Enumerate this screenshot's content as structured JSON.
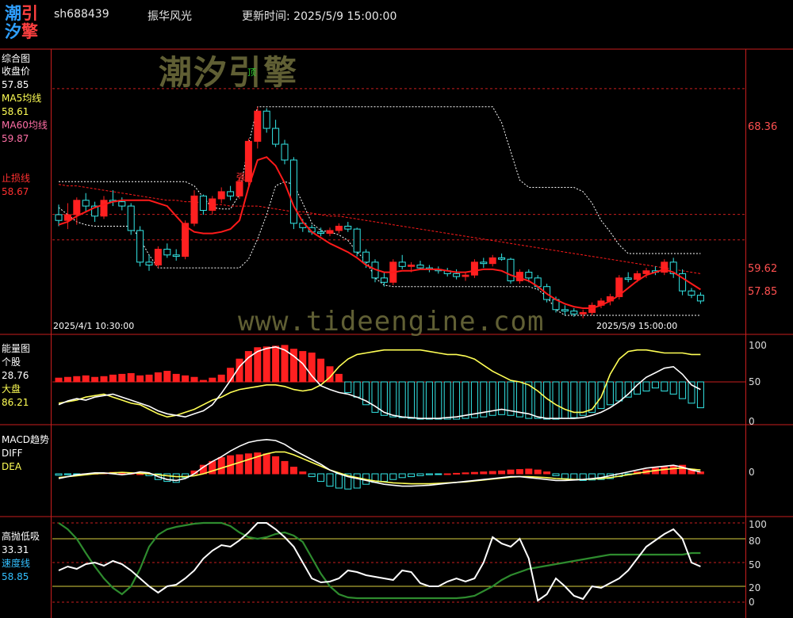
{
  "header": {
    "logo_chars": [
      "潮",
      "引",
      "汐",
      "擎"
    ],
    "code": "sh688439",
    "name": "振华风光",
    "update_time": "更新时间: 2025/5/9 15:00:00"
  },
  "watermarks": {
    "cn": "潮汐引擎",
    "url": "www.tideengine.com"
  },
  "panels": {
    "main": {
      "title": "综合图",
      "close_label": "收盘价",
      "close_value": "57.85",
      "ma5_label": "MA5均线",
      "ma5_value": "58.61",
      "ma60_label": "MA60均线",
      "ma60_value": "59.87",
      "stop_label": "止损线",
      "stop_value": "58.67",
      "date_start": "2025/4/1 10:30:00",
      "date_end": "2025/5/9 15:00:00",
      "right_ticks": [
        "68.36",
        "59.62",
        "57.85"
      ],
      "marks": {
        "top": "顶",
        "strong": "强"
      }
    },
    "energy": {
      "title": "能量图",
      "stock_label": "个股",
      "stock_value": "28.76",
      "market_label": "大盘",
      "market_value": "86.21",
      "ticks": [
        "100",
        "50",
        "0"
      ]
    },
    "macd": {
      "title": "MACD趋势",
      "diff_label": "DIFF",
      "dea_label": "DEA",
      "ticks": [
        "0"
      ]
    },
    "osc": {
      "title": "高抛低吸",
      "value": "33.31",
      "speed_label": "速度线",
      "speed_value": "58.85",
      "ticks": [
        "100",
        "80",
        "50",
        "20",
        "0"
      ]
    }
  },
  "colors": {
    "up": "#ff2020",
    "down": "#33e6e6",
    "ma60": "#ff1a1a",
    "yellow": "#ffff55",
    "white": "#ffffff",
    "green": "#2e8b2e",
    "grid": "#c81e1e",
    "label_white": "#ffffff",
    "label_yellow": "#ffff55",
    "label_pink": "#ff6fa6",
    "label_red": "#ff3030",
    "label_cyan": "#33c0ff"
  },
  "chart_data": {
    "type": "line",
    "bars_count": 72,
    "candles": [
      [
        59.6,
        60.3,
        58.8,
        59.2
      ],
      [
        59.2,
        60.4,
        58.6,
        59.6
      ],
      [
        59.6,
        60.8,
        58.9,
        60.6
      ],
      [
        60.6,
        61.1,
        59.8,
        60.2
      ],
      [
        60.2,
        60.5,
        59.1,
        59.5
      ],
      [
        59.5,
        60.9,
        59.3,
        60.6
      ],
      [
        60.6,
        61.3,
        60.2,
        60.5
      ],
      [
        60.5,
        60.8,
        59.9,
        60.2
      ],
      [
        60.2,
        60.4,
        58.2,
        58.5
      ],
      [
        58.5,
        58.8,
        56.0,
        56.3
      ],
      [
        56.3,
        56.8,
        55.7,
        56.1
      ],
      [
        56.1,
        57.4,
        55.9,
        57.2
      ],
      [
        57.2,
        57.6,
        56.6,
        56.8
      ],
      [
        56.8,
        57.2,
        56.4,
        56.7
      ],
      [
        56.7,
        59.2,
        56.5,
        59.0
      ],
      [
        59.0,
        61.3,
        58.8,
        60.9
      ],
      [
        60.9,
        61.0,
        59.6,
        59.9
      ],
      [
        59.9,
        60.9,
        59.6,
        60.7
      ],
      [
        60.7,
        61.5,
        60.4,
        61.2
      ],
      [
        61.2,
        61.6,
        60.6,
        60.9
      ],
      [
        60.9,
        62.2,
        60.7,
        61.9
      ],
      [
        61.9,
        64.9,
        61.6,
        64.7
      ],
      [
        64.7,
        67.1,
        64.2,
        66.8
      ],
      [
        66.8,
        67.0,
        65.3,
        65.6
      ],
      [
        65.6,
        66.2,
        64.3,
        64.5
      ],
      [
        64.5,
        64.8,
        63.1,
        63.4
      ],
      [
        63.4,
        63.6,
        58.6,
        59.0
      ],
      [
        59.0,
        59.3,
        58.4,
        58.7
      ],
      [
        58.7,
        58.9,
        58.2,
        58.4
      ],
      [
        58.4,
        58.7,
        58.1,
        58.3
      ],
      [
        58.3,
        58.7,
        58.1,
        58.5
      ],
      [
        58.5,
        59.0,
        58.3,
        58.8
      ],
      [
        58.8,
        59.1,
        58.4,
        58.6
      ],
      [
        58.6,
        58.7,
        56.7,
        57.0
      ],
      [
        57.0,
        57.2,
        55.9,
        56.3
      ],
      [
        56.3,
        56.5,
        54.9,
        55.2
      ],
      [
        55.2,
        55.6,
        54.6,
        54.9
      ],
      [
        54.9,
        56.5,
        54.7,
        56.3
      ],
      [
        56.3,
        56.8,
        55.8,
        56.0
      ],
      [
        56.0,
        56.3,
        55.6,
        56.1
      ],
      [
        56.1,
        56.4,
        55.8,
        55.9
      ],
      [
        55.9,
        56.1,
        55.6,
        55.8
      ],
      [
        55.8,
        56.0,
        55.5,
        55.7
      ],
      [
        55.7,
        55.9,
        55.3,
        55.5
      ],
      [
        55.5,
        55.8,
        55.1,
        55.3
      ],
      [
        55.3,
        55.6,
        55.0,
        55.4
      ],
      [
        55.4,
        56.5,
        55.2,
        56.3
      ],
      [
        56.3,
        56.6,
        55.9,
        56.2
      ],
      [
        56.2,
        56.8,
        56.0,
        56.6
      ],
      [
        56.6,
        56.9,
        56.4,
        56.5
      ],
      [
        56.5,
        56.6,
        54.8,
        55.0
      ],
      [
        55.0,
        55.8,
        54.8,
        55.6
      ],
      [
        55.6,
        55.8,
        54.9,
        55.2
      ],
      [
        55.2,
        55.4,
        54.4,
        54.6
      ],
      [
        54.6,
        54.8,
        53.5,
        53.7
      ],
      [
        53.7,
        53.9,
        52.8,
        53.0
      ],
      [
        53.0,
        53.3,
        52.6,
        52.9
      ],
      [
        52.9,
        53.1,
        52.5,
        52.7
      ],
      [
        52.7,
        53.0,
        52.4,
        52.8
      ],
      [
        52.8,
        53.5,
        52.6,
        53.3
      ],
      [
        53.3,
        53.8,
        53.1,
        53.6
      ],
      [
        53.6,
        54.1,
        53.3,
        53.9
      ],
      [
        53.9,
        55.4,
        53.7,
        55.2
      ],
      [
        55.2,
        55.6,
        54.9,
        55.1
      ],
      [
        55.1,
        55.7,
        54.9,
        55.5
      ],
      [
        55.5,
        55.9,
        55.2,
        55.7
      ],
      [
        55.7,
        56.0,
        55.4,
        55.6
      ],
      [
        55.6,
        56.5,
        55.4,
        56.3
      ],
      [
        56.3,
        56.6,
        55.2,
        55.5
      ],
      [
        55.5,
        55.8,
        54.0,
        54.3
      ],
      [
        54.3,
        54.5,
        53.8,
        54.0
      ],
      [
        54.0,
        54.2,
        53.4,
        53.6
      ]
    ],
    "ma5": [
      59.9,
      59.9,
      60.0,
      60.1,
      60.0,
      59.9,
      60.0,
      59.9,
      59.6,
      59.0,
      58.4,
      57.8,
      57.1,
      56.6,
      57.0,
      57.8,
      58.6,
      59.4,
      60.0,
      60.6,
      60.8,
      61.8,
      63.0,
      63.6,
      63.9,
      63.8,
      62.8,
      61.6,
      60.6,
      59.4,
      58.6,
      58.4,
      58.3,
      58.0,
      57.6,
      57.0,
      56.5,
      56.0,
      55.8,
      55.6,
      55.5,
      55.5,
      55.6,
      55.6,
      55.5,
      55.4,
      55.5,
      55.6,
      55.7,
      55.8,
      55.8,
      55.8,
      55.6,
      55.3,
      54.9,
      54.5,
      54.0,
      53.6,
      53.2,
      53.1,
      53.2,
      53.4,
      53.8,
      54.2,
      54.6,
      55.0,
      55.3,
      55.5,
      55.6,
      55.5,
      55.2,
      54.8
    ],
    "ma60": [
      61.7,
      61.6,
      61.6,
      61.5,
      61.4,
      61.3,
      61.2,
      61.1,
      61.0,
      60.9,
      60.8,
      60.7,
      60.6,
      60.6,
      60.5,
      60.5,
      60.4,
      60.3,
      60.3,
      60.2,
      60.2,
      60.2,
      60.2,
      60.1,
      60.0,
      59.9,
      59.8,
      59.8,
      59.7,
      59.6,
      59.5,
      59.5,
      59.4,
      59.3,
      59.2,
      59.1,
      59.0,
      58.9,
      58.8,
      58.7,
      58.6,
      58.5,
      58.4,
      58.3,
      58.2,
      58.1,
      58.0,
      57.9,
      57.8,
      57.7,
      57.6,
      57.5,
      57.4,
      57.3,
      57.2,
      57.1,
      57.0,
      56.9,
      56.8,
      56.7,
      56.6,
      56.5,
      56.4,
      56.3,
      56.2,
      56.1,
      56.0,
      55.9,
      55.8,
      55.7,
      55.6,
      55.5
    ],
    "stop_line": [
      58.9,
      59.1,
      59.5,
      59.8,
      60.1,
      60.3,
      60.5,
      60.6,
      60.6,
      60.6,
      60.6,
      60.4,
      60.2,
      59.5,
      58.8,
      58.4,
      58.3,
      58.3,
      58.4,
      58.6,
      59.2,
      61.5,
      63.4,
      63.6,
      63.0,
      61.8,
      60.2,
      59.1,
      58.4,
      58.0,
      57.6,
      57.3,
      57.0,
      56.6,
      56.1,
      55.8,
      55.6,
      55.6,
      55.7,
      55.7,
      55.8,
      55.8,
      55.8,
      55.7,
      55.6,
      55.6,
      55.7,
      55.8,
      55.8,
      55.7,
      55.4,
      55.2,
      55.0,
      54.6,
      54.1,
      53.7,
      53.4,
      53.2,
      53.1,
      53.1,
      53.3,
      53.6,
      54.0,
      54.5,
      55.0,
      55.4,
      55.6,
      55.8,
      55.6,
      55.2,
      54.8,
      54.4
    ],
    "resistance": [
      61.9,
      61.9,
      61.9,
      61.9,
      61.9,
      61.9,
      61.9,
      61.9,
      61.9,
      61.9,
      61.9,
      61.9,
      61.9,
      61.9,
      61.9,
      61.6,
      60.8,
      60.1,
      60.0,
      60.0,
      61.0,
      64.5,
      67.1,
      67.1,
      67.1,
      67.1,
      67.1,
      67.1,
      67.1,
      67.1,
      67.1,
      67.1,
      67.1,
      67.1,
      67.1,
      67.1,
      67.1,
      67.1,
      67.1,
      67.1,
      67.1,
      67.1,
      67.1,
      67.1,
      67.1,
      67.1,
      67.1,
      67.1,
      67.1,
      66.0,
      64.0,
      62.0,
      61.5,
      61.5,
      61.5,
      61.5,
      61.5,
      61.5,
      61.2,
      60.4,
      59.2,
      58.4,
      57.5,
      56.9,
      56.9,
      56.9,
      56.9,
      56.9,
      56.9,
      56.9,
      56.9,
      56.9
    ],
    "support": [
      60.1,
      59.6,
      59.1,
      58.9,
      58.8,
      58.8,
      58.8,
      58.8,
      58.8,
      57.9,
      56.8,
      55.9,
      55.9,
      55.9,
      55.9,
      55.9,
      55.9,
      55.9,
      55.9,
      55.9,
      55.9,
      56.5,
      57.9,
      59.6,
      61.6,
      61.9,
      61.7,
      60.4,
      59.0,
      58.5,
      58.4,
      58.2,
      57.8,
      57.0,
      56.4,
      55.2,
      54.7,
      54.6,
      54.6,
      54.6,
      54.6,
      54.6,
      54.6,
      54.6,
      54.6,
      54.6,
      54.6,
      54.6,
      54.6,
      54.6,
      54.6,
      54.6,
      54.6,
      54.4,
      53.9,
      53.0,
      52.6,
      52.6,
      52.6,
      52.6,
      52.6,
      52.6,
      52.6,
      52.6,
      52.6,
      52.6,
      52.6,
      52.6,
      52.6,
      52.6,
      52.6,
      52.6
    ],
    "price_axis": [
      51.5,
      71.0
    ],
    "h_levels": [
      68.36,
      59.62,
      57.85
    ],
    "energy_bars": [
      5,
      6,
      7,
      8,
      6,
      7,
      9,
      10,
      11,
      8,
      9,
      12,
      14,
      10,
      8,
      6,
      2,
      5,
      9,
      18,
      30,
      40,
      45,
      46,
      47,
      48,
      43,
      40,
      38,
      30,
      20,
      10,
      -14,
      -20,
      -30,
      -40,
      -44,
      -46,
      -47,
      -48,
      -49,
      -49,
      -49,
      -49,
      -49,
      -48,
      -47,
      -46,
      -44,
      -43,
      -44,
      -46,
      -48,
      -48,
      -49,
      -49,
      -48,
      -47,
      -44,
      -40,
      -35,
      -30,
      -25,
      -20,
      -16,
      -12,
      -8,
      -12,
      -16,
      -22,
      -28,
      -34
    ],
    "energy_white": [
      20,
      25,
      28,
      26,
      30,
      32,
      34,
      30,
      26,
      22,
      18,
      12,
      8,
      6,
      4,
      8,
      12,
      20,
      35,
      52,
      70,
      82,
      90,
      94,
      96,
      92,
      84,
      74,
      58,
      45,
      40,
      36,
      34,
      30,
      25,
      18,
      10,
      6,
      4,
      3,
      2,
      2,
      2,
      3,
      4,
      6,
      8,
      10,
      12,
      14,
      12,
      10,
      8,
      4,
      2,
      2,
      2,
      2,
      3,
      6,
      10,
      16,
      24,
      34,
      46,
      56,
      62,
      68,
      70,
      60,
      46,
      40
    ],
    "energy_yellow": [
      22,
      24,
      26,
      30,
      32,
      34,
      30,
      26,
      22,
      20,
      14,
      8,
      4,
      6,
      10,
      14,
      20,
      26,
      30,
      36,
      40,
      42,
      44,
      46,
      46,
      44,
      40,
      38,
      40,
      46,
      56,
      70,
      80,
      86,
      88,
      90,
      92,
      92,
      92,
      92,
      92,
      90,
      88,
      86,
      86,
      84,
      80,
      72,
      64,
      58,
      52,
      50,
      46,
      38,
      28,
      20,
      14,
      10,
      10,
      14,
      30,
      60,
      80,
      90,
      92,
      92,
      90,
      88,
      88,
      88,
      86,
      86
    ],
    "macd_bars": [
      -3,
      -2,
      -1,
      0,
      1,
      2,
      3,
      2,
      1,
      0,
      -4,
      -12,
      -16,
      -18,
      -8,
      6,
      18,
      26,
      34,
      38,
      40,
      42,
      44,
      42,
      36,
      26,
      14,
      4,
      -6,
      -16,
      -26,
      -30,
      -32,
      -30,
      -22,
      -18,
      -16,
      -12,
      -8,
      -6,
      -4,
      -2,
      -1,
      0,
      1,
      2,
      3,
      4,
      5,
      6,
      8,
      9,
      10,
      8,
      4,
      -4,
      -10,
      -13,
      -14,
      -13,
      -12,
      -10,
      -6,
      -2,
      4,
      8,
      12,
      14,
      16,
      18,
      10,
      4
    ],
    "macd_white": [
      -10,
      -6,
      -2,
      0,
      2,
      2,
      0,
      -2,
      0,
      4,
      2,
      -6,
      -12,
      -14,
      -10,
      0,
      14,
      26,
      36,
      48,
      58,
      66,
      70,
      72,
      70,
      62,
      50,
      40,
      30,
      20,
      8,
      0,
      -6,
      -10,
      -14,
      -18,
      -22,
      -24,
      -26,
      -26,
      -25,
      -24,
      -22,
      -20,
      -18,
      -16,
      -14,
      -12,
      -10,
      -8,
      -6,
      -6,
      -8,
      -10,
      -12,
      -14,
      -14,
      -13,
      -12,
      -10,
      -8,
      -4,
      0,
      4,
      8,
      12,
      14,
      16,
      18,
      14,
      8,
      4
    ],
    "macd_yellow": [
      -8,
      -6,
      -4,
      -2,
      0,
      1,
      2,
      3,
      2,
      1,
      0,
      -2,
      -4,
      -6,
      -6,
      -4,
      0,
      6,
      12,
      18,
      24,
      30,
      36,
      42,
      46,
      46,
      40,
      32,
      24,
      16,
      8,
      2,
      -4,
      -8,
      -12,
      -15,
      -17,
      -19,
      -20,
      -21,
      -21,
      -21,
      -20,
      -19,
      -18,
      -17,
      -15,
      -13,
      -11,
      -9,
      -7,
      -6,
      -6,
      -7,
      -8,
      -10,
      -11,
      -12,
      -12,
      -11,
      -10,
      -8,
      -5,
      -2,
      1,
      4,
      7,
      9,
      11,
      12,
      10,
      8
    ],
    "osc_white": [
      40,
      45,
      42,
      48,
      50,
      46,
      52,
      48,
      40,
      30,
      20,
      12,
      20,
      22,
      30,
      40,
      55,
      65,
      72,
      70,
      78,
      88,
      100,
      100,
      92,
      82,
      70,
      50,
      30,
      25,
      26,
      30,
      40,
      38,
      34,
      32,
      30,
      28,
      40,
      38,
      24,
      20,
      20,
      26,
      30,
      26,
      30,
      50,
      82,
      74,
      70,
      80,
      55,
      2,
      10,
      30,
      20,
      8,
      4,
      20,
      18,
      24,
      30,
      40,
      55,
      70,
      78,
      86,
      92,
      80,
      50,
      45
    ],
    "osc_green": [
      100,
      92,
      80,
      62,
      45,
      30,
      18,
      10,
      20,
      42,
      70,
      85,
      92,
      95,
      97,
      99,
      100,
      100,
      100,
      96,
      88,
      82,
      80,
      82,
      86,
      88,
      84,
      76,
      56,
      36,
      20,
      10,
      6,
      5,
      5,
      5,
      5,
      5,
      5,
      5,
      5,
      5,
      5,
      5,
      5,
      6,
      8,
      14,
      20,
      28,
      34,
      38,
      42,
      44,
      46,
      48,
      50,
      52,
      54,
      56,
      58,
      60,
      60,
      60,
      60,
      60,
      60,
      60,
      60,
      60,
      62,
      62
    ],
    "osc_ticks": [
      100,
      80,
      50,
      20,
      0
    ]
  }
}
